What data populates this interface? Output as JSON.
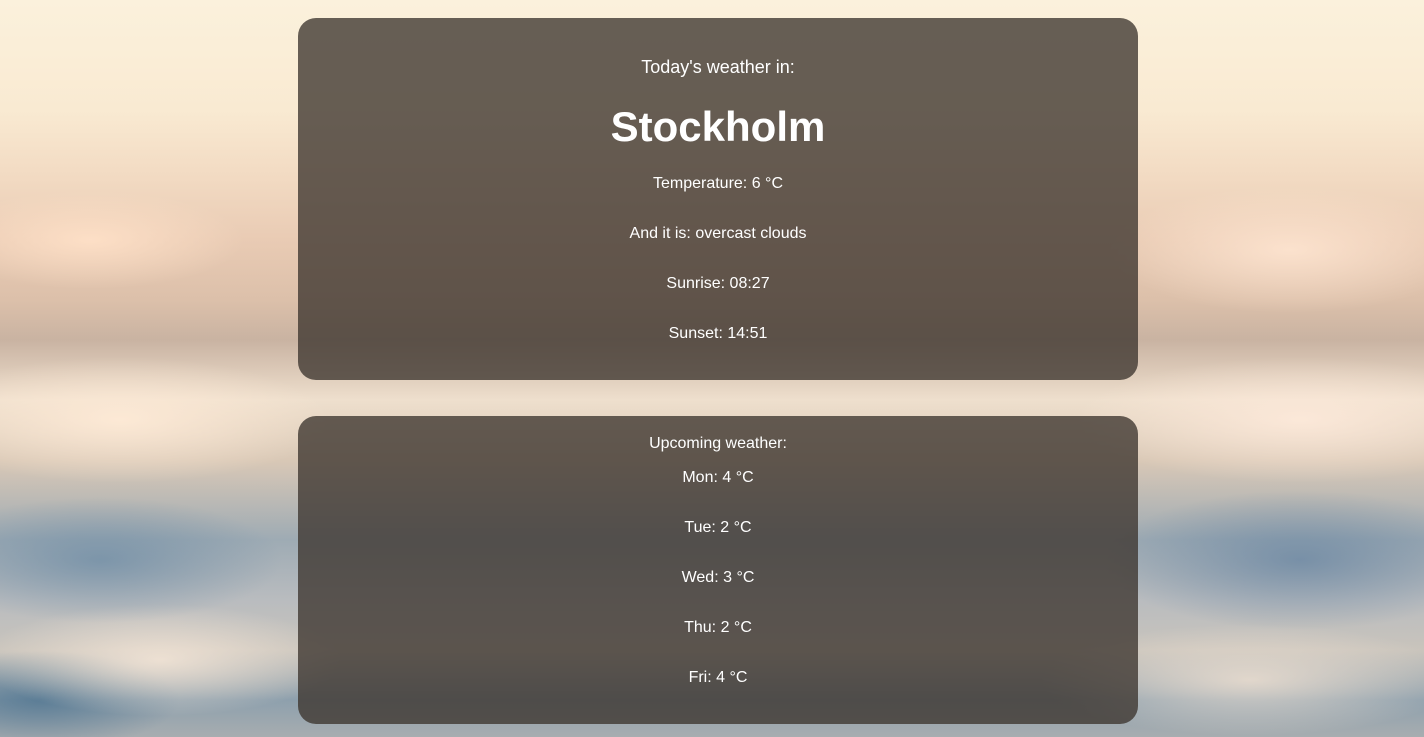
{
  "today": {
    "heading": "Today's weather in:",
    "city": "Stockholm",
    "temperature": "Temperature: 6 °C",
    "condition": "And it is: overcast clouds",
    "sunrise": "Sunrise: 08:27",
    "sunset": "Sunset: 14:51"
  },
  "upcoming": {
    "heading": "Upcoming weather:",
    "days": [
      {
        "text": "Mon: 4 °C"
      },
      {
        "text": "Tue: 2 °C"
      },
      {
        "text": "Wed: 3 °C"
      },
      {
        "text": "Thu: 2 °C"
      },
      {
        "text": "Fri: 4 °C"
      }
    ]
  }
}
